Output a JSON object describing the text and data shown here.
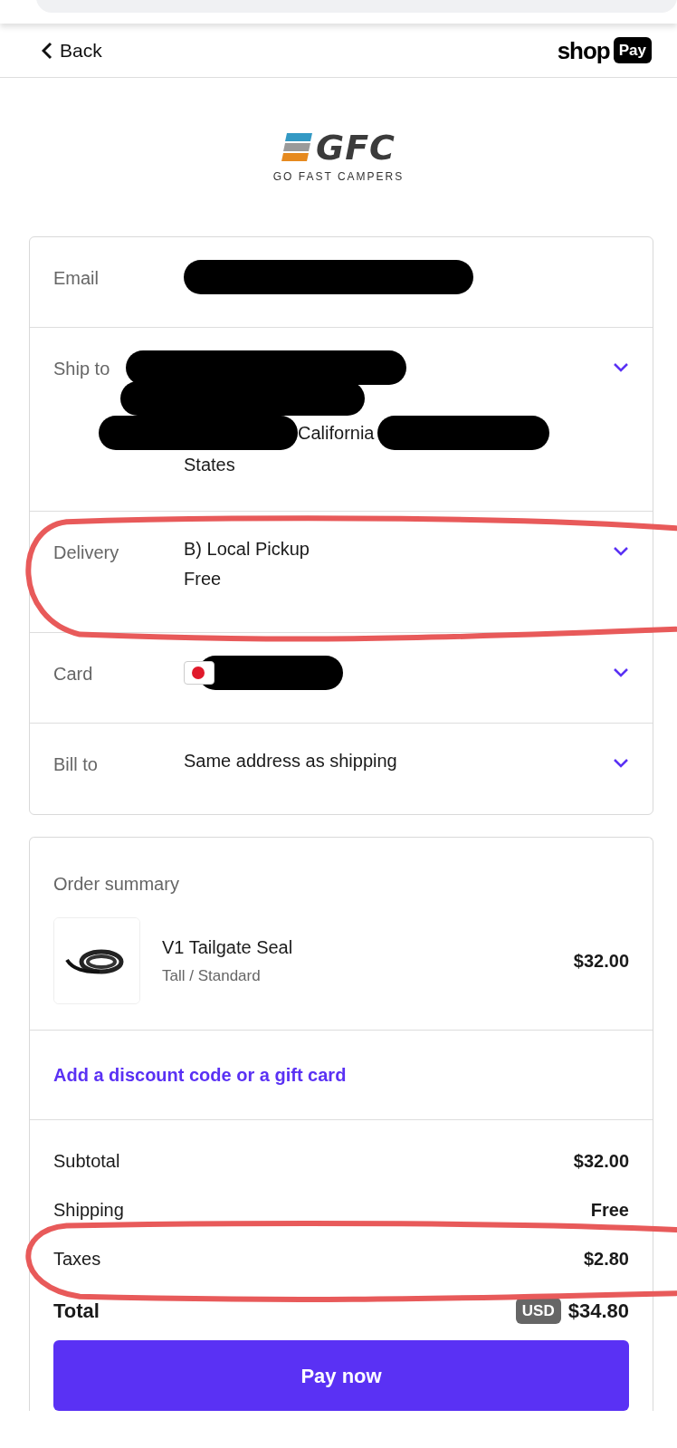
{
  "header": {
    "back_label": "Back",
    "brand_shop": "shop",
    "brand_pay": "Pay"
  },
  "logo": {
    "mark": "GFC",
    "tagline": "GO FAST CAMPERS"
  },
  "details": [
    {
      "kind": "email",
      "label": "Email",
      "redacted": true,
      "expandable": false,
      "annotated": false
    },
    {
      "kind": "address",
      "label": "Ship to",
      "redacted": true,
      "lines": [
        "California",
        "States"
      ],
      "expandable": true,
      "annotated": false
    },
    {
      "kind": "text",
      "label": "Delivery",
      "lines": [
        "B) Local Pickup",
        "Free"
      ],
      "expandable": true,
      "annotated": true
    },
    {
      "kind": "card",
      "label": "Card",
      "redacted": true,
      "expandable": true,
      "annotated": false
    },
    {
      "kind": "text",
      "label": "Bill to",
      "lines": [
        "Same address as shipping"
      ],
      "expandable": true,
      "annotated": false
    }
  ],
  "summary": {
    "title": "Order summary",
    "items": [
      {
        "name": "V1 Tailgate Seal",
        "variant": "Tall / Standard",
        "price": "$32.00"
      }
    ],
    "discount_link": "Add a discount code or a gift card",
    "lines": [
      {
        "label": "Subtotal",
        "value": "$32.00",
        "annotated": false
      },
      {
        "label": "Shipping",
        "value": "Free",
        "annotated": false
      },
      {
        "label": "Taxes",
        "value": "$2.80",
        "annotated": true
      }
    ],
    "total": {
      "label": "Total",
      "currency": "USD",
      "value": "$34.80"
    },
    "pay_button": "Pay now"
  }
}
